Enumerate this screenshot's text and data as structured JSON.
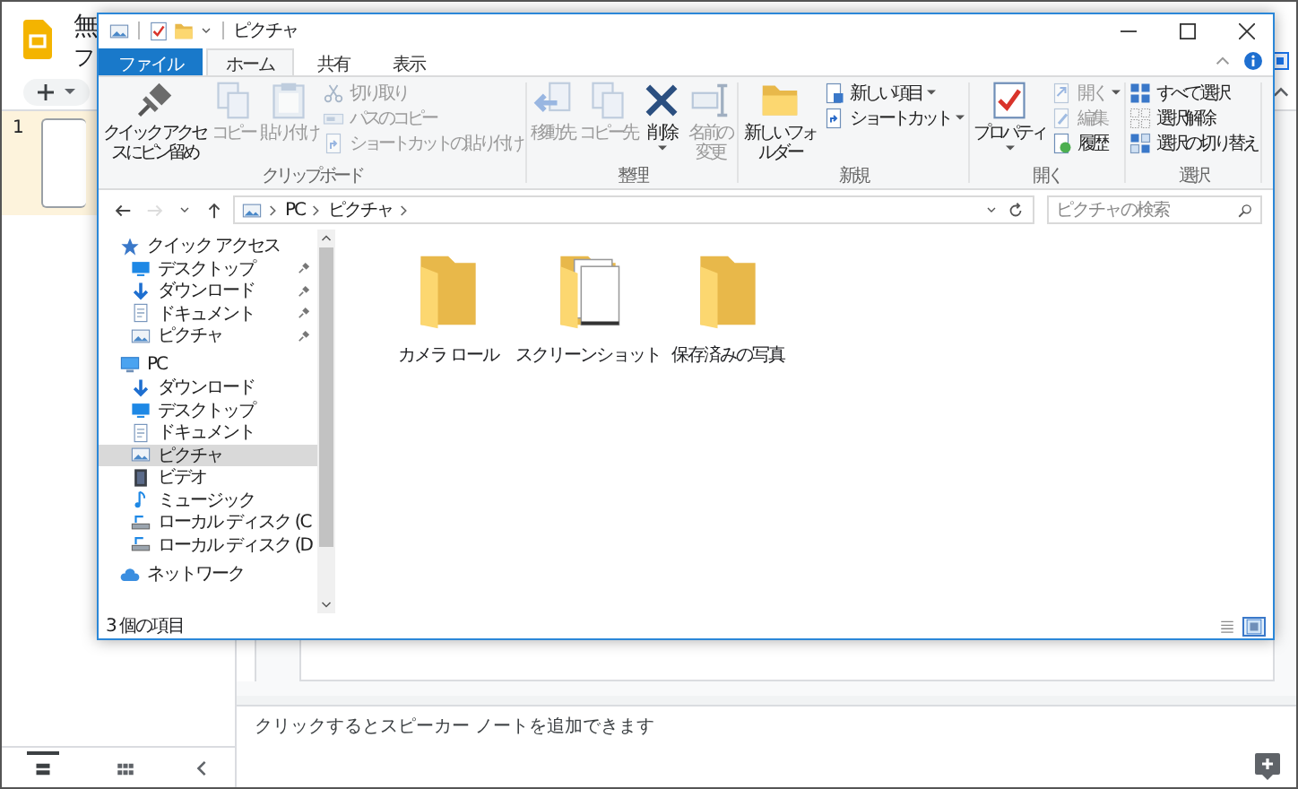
{
  "app": {
    "title": "無",
    "menu_label": "フ",
    "slide_number": "1",
    "notes_placeholder": "クリックするとスピーカー ノートを追加できます",
    "view_buttons": [
      {
        "kind": "filmstrip",
        "selected": true
      },
      {
        "kind": "grid",
        "selected": false
      }
    ]
  },
  "explorer": {
    "title": "ピクチャ",
    "ribbon": {
      "tabs": [
        {
          "label": "ファイル",
          "kind": "file",
          "selected": false
        },
        {
          "label": "ホーム",
          "kind": "tab",
          "selected": true
        },
        {
          "label": "共有",
          "kind": "tab",
          "selected": false
        },
        {
          "label": "表示",
          "kind": "tab",
          "selected": false
        }
      ],
      "groups": [
        {
          "label": "クリップボード",
          "large": [
            {
              "kind": "pin",
              "label": "クイック アクセスにピン留め",
              "disabled": false,
              "dropdown": false
            },
            {
              "kind": "copy",
              "label": "コピー",
              "disabled": true,
              "dropdown": false
            },
            {
              "kind": "paste",
              "label": "貼り付け",
              "disabled": true,
              "dropdown": false
            }
          ],
          "small": [
            {
              "kind": "cut",
              "label": "切り取り",
              "disabled": true,
              "dropdown": false
            },
            {
              "kind": "copy-path",
              "label": "パスのコピー",
              "disabled": true,
              "dropdown": false
            },
            {
              "kind": "paste-shortcut",
              "label": "ショートカットの貼り付け",
              "disabled": true,
              "dropdown": false
            }
          ]
        },
        {
          "label": "整理",
          "large": [
            {
              "kind": "move-to",
              "label": "移動先",
              "disabled": true,
              "dropdown": false
            },
            {
              "kind": "copy-to",
              "label": "コピー先",
              "disabled": true,
              "dropdown": false
            },
            {
              "kind": "delete",
              "label": "削除",
              "disabled": false,
              "dropdown": true
            },
            {
              "kind": "rename",
              "label": "名前の変更",
              "disabled": true,
              "dropdown": false
            }
          ]
        },
        {
          "label": "新規",
          "large": [
            {
              "kind": "new-folder",
              "label": "新しいフォルダー",
              "disabled": false,
              "dropdown": false
            }
          ],
          "small": [
            {
              "kind": "new-item",
              "label": "新しい項目",
              "disabled": false,
              "dropdown": true
            },
            {
              "kind": "shortcut",
              "label": "ショートカット",
              "disabled": false,
              "dropdown": true
            }
          ]
        },
        {
          "label": "開く",
          "large": [
            {
              "kind": "properties",
              "label": "プロパティ",
              "disabled": false,
              "dropdown": true
            }
          ],
          "small": [
            {
              "kind": "open",
              "label": "開く",
              "disabled": true,
              "dropdown": true
            },
            {
              "kind": "edit",
              "label": "編集",
              "disabled": true,
              "dropdown": false
            },
            {
              "kind": "history",
              "label": "履歴",
              "disabled": false,
              "dropdown": false
            }
          ]
        },
        {
          "label": "選択",
          "small": [
            {
              "kind": "select-all",
              "label": "すべて選択",
              "disabled": false,
              "dropdown": false
            },
            {
              "kind": "select-none",
              "label": "選択解除",
              "disabled": false,
              "dropdown": false
            },
            {
              "kind": "invert",
              "label": "選択の切り替え",
              "disabled": false,
              "dropdown": false
            }
          ]
        }
      ]
    },
    "nav_buttons": [
      {
        "kind": "back",
        "disabled": false
      },
      {
        "kind": "forward",
        "disabled": true
      },
      {
        "kind": "recent",
        "disabled": false
      },
      {
        "kind": "up",
        "disabled": false
      }
    ],
    "address": {
      "path": [
        "PC",
        "ピクチャ"
      ]
    },
    "search": {
      "placeholder": "ピクチャの検索"
    },
    "navigation": [
      {
        "label": "クイック アクセス",
        "kind": "star",
        "selected": false,
        "children": [
          {
            "label": "デスクトップ",
            "kind": "desktop",
            "selected": false,
            "pinned": true
          },
          {
            "label": "ダウンロード",
            "kind": "download",
            "selected": false,
            "pinned": true
          },
          {
            "label": "ドキュメント",
            "kind": "document",
            "selected": false,
            "pinned": true
          },
          {
            "label": "ピクチャ",
            "kind": "pictures",
            "selected": false,
            "pinned": true
          }
        ]
      },
      {
        "label": "PC",
        "kind": "pc",
        "selected": false,
        "children": [
          {
            "label": "ダウンロード",
            "kind": "download",
            "selected": false
          },
          {
            "label": "デスクトップ",
            "kind": "desktop",
            "selected": false
          },
          {
            "label": "ドキュメント",
            "kind": "document",
            "selected": false
          },
          {
            "label": "ピクチャ",
            "kind": "pictures",
            "selected": true
          },
          {
            "label": "ビデオ",
            "kind": "video",
            "selected": false
          },
          {
            "label": "ミュージック",
            "kind": "music",
            "selected": false
          },
          {
            "label": "ローカル ディスク (C",
            "kind": "drive",
            "selected": false
          },
          {
            "label": "ローカル ディスク (D",
            "kind": "drive",
            "selected": false
          }
        ]
      },
      {
        "label": "ネットワーク",
        "kind": "network",
        "selected": false
      }
    ],
    "items": [
      {
        "label": "カメラ ロール",
        "kind": "folder",
        "selected": false
      },
      {
        "label": "スクリーンショット",
        "kind": "folder-pages",
        "selected": false
      },
      {
        "label": "保存済みの写真",
        "kind": "folder",
        "selected": false
      }
    ],
    "status": "3 個の項目",
    "view_modes": [
      {
        "kind": "details",
        "selected": false
      },
      {
        "kind": "large-icons",
        "selected": true
      }
    ]
  }
}
